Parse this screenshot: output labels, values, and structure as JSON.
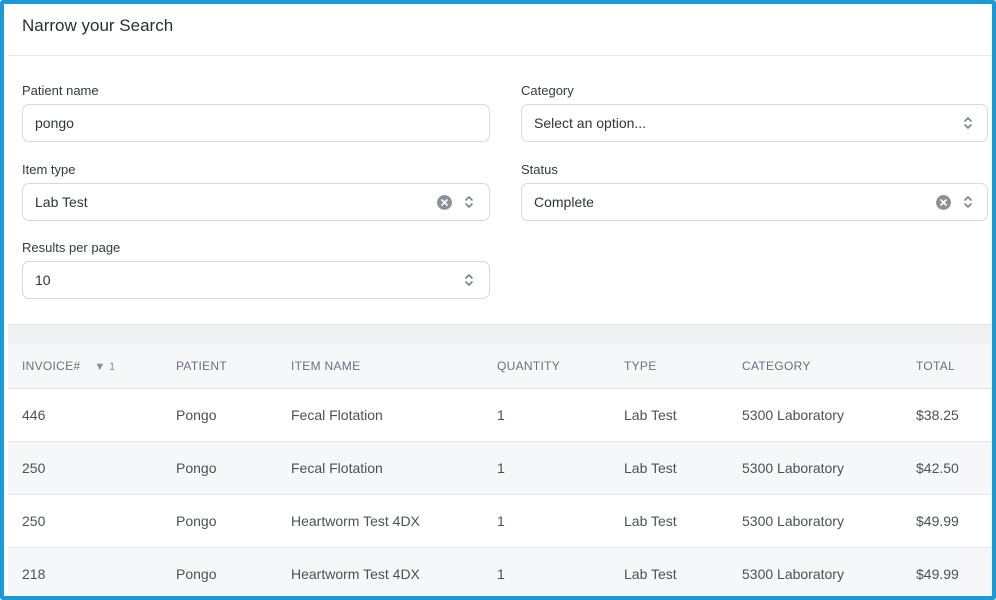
{
  "header": {
    "title": "Narrow your Search"
  },
  "filters": {
    "patient_name": {
      "label": "Patient name",
      "value": "pongo"
    },
    "category": {
      "label": "Category",
      "placeholder": "Select an option..."
    },
    "item_type": {
      "label": "Item type",
      "value": "Lab Test"
    },
    "status": {
      "label": "Status",
      "value": "Complete"
    },
    "results_per_page": {
      "label": "Results per page",
      "value": "10"
    }
  },
  "table": {
    "columns": [
      "INVOICE#",
      "PATIENT",
      "ITEM NAME",
      "QUANTITY",
      "TYPE",
      "CATEGORY",
      "TOTAL"
    ],
    "sort_indicator": "▼ 1",
    "rows": [
      {
        "invoice": "446",
        "patient": "Pongo",
        "item": "Fecal Flotation",
        "quantity": "1",
        "type": "Lab Test",
        "category": "5300 Laboratory",
        "total": "$38.25"
      },
      {
        "invoice": "250",
        "patient": "Pongo",
        "item": "Fecal Flotation",
        "quantity": "1",
        "type": "Lab Test",
        "category": "5300 Laboratory",
        "total": "$42.50"
      },
      {
        "invoice": "250",
        "patient": "Pongo",
        "item": "Heartworm Test 4DX",
        "quantity": "1",
        "type": "Lab Test",
        "category": "5300 Laboratory",
        "total": "$49.99"
      },
      {
        "invoice": "218",
        "patient": "Pongo",
        "item": "Heartworm Test 4DX",
        "quantity": "1",
        "type": "Lab Test",
        "category": "5300 Laboratory",
        "total": "$49.99"
      }
    ]
  },
  "icons": {
    "chevron": "chevron-updown-icon",
    "clear": "clear-circle-icon"
  },
  "colors": {
    "frame_border": "#1a9ad6",
    "row_alt": "#f6f7f9"
  }
}
